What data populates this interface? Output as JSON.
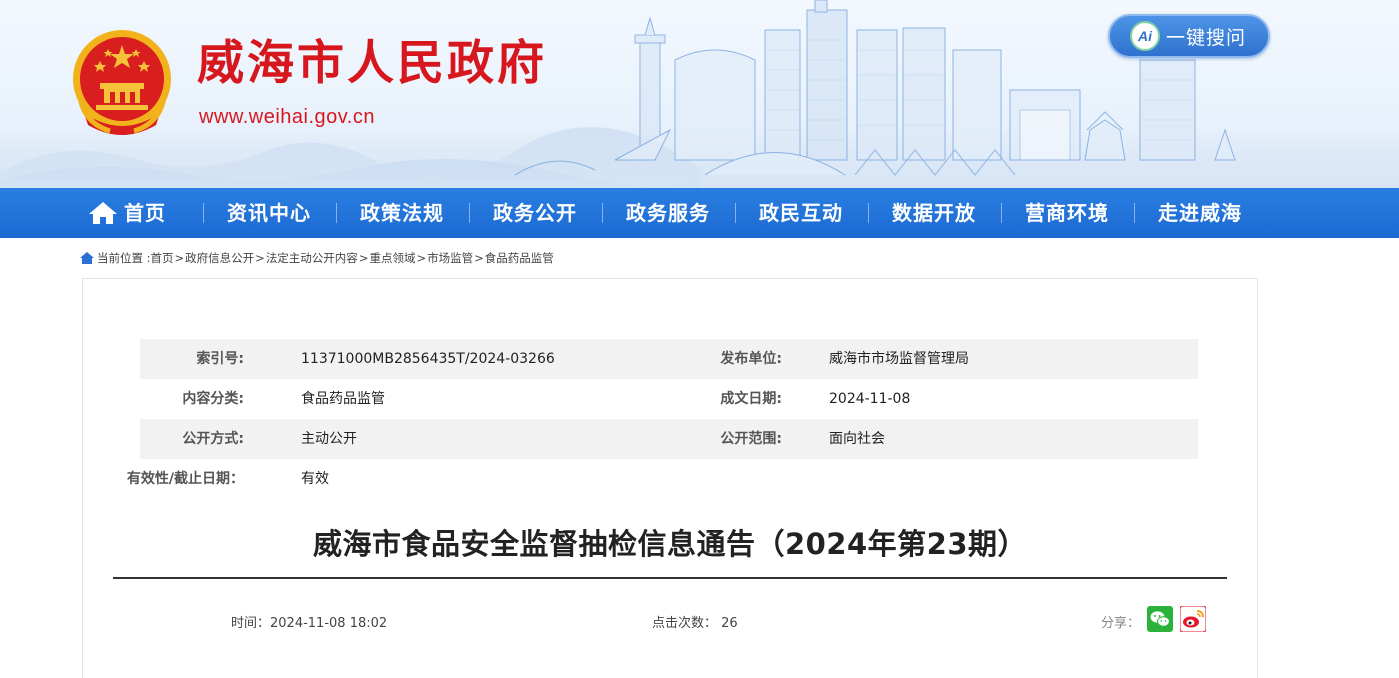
{
  "header": {
    "site_title": "威海市人民政府",
    "site_url": "www.weihai.gov.cn",
    "ai_search": {
      "badge": "Ai",
      "label": "一键搜问"
    }
  },
  "nav": {
    "items": [
      {
        "label": "首页"
      },
      {
        "label": "资讯中心"
      },
      {
        "label": "政策法规"
      },
      {
        "label": "政务公开"
      },
      {
        "label": "政务服务"
      },
      {
        "label": "政民互动"
      },
      {
        "label": "数据开放"
      },
      {
        "label": "营商环境"
      },
      {
        "label": "走进威海"
      }
    ]
  },
  "breadcrumb": {
    "prefix": "当前位置 :",
    "separator": ">",
    "items": [
      "首页",
      "政府信息公开",
      "法定主动公开内容",
      "重点领域",
      "市场监管",
      "食品药品监管"
    ]
  },
  "meta": {
    "rows": [
      {
        "label1": "索引号:",
        "value1": "11371000MB2856435T/2024-03266",
        "label2": "发布单位:",
        "value2": "威海市市场监督管理局"
      },
      {
        "label1": "内容分类:",
        "value1": "食品药品监管",
        "label2": "成文日期:",
        "value2": "2024-11-08"
      },
      {
        "label1": "公开方式:",
        "value1": "主动公开",
        "label2": "公开范围:",
        "value2": "面向社会"
      },
      {
        "label1": "有效性/截止日期：",
        "value1": "有效"
      }
    ]
  },
  "article": {
    "title": "威海市食品安全监督抽检信息通告（2024年第23期）",
    "time_label": "时间：",
    "time_value": "2024-11-08 18:02",
    "clicks_label": "点击次数：",
    "clicks_value": "26",
    "share_label": "分享："
  },
  "colors": {
    "brand_red": "#d6181e",
    "nav_blue": "#1c6ad3",
    "wechat_green": "#2bb23b",
    "weibo_red": "#e6162d"
  },
  "icons": [
    "national-emblem",
    "ai-icon",
    "home-icon",
    "location-pin-icon",
    "wechat-icon",
    "weibo-icon"
  ]
}
